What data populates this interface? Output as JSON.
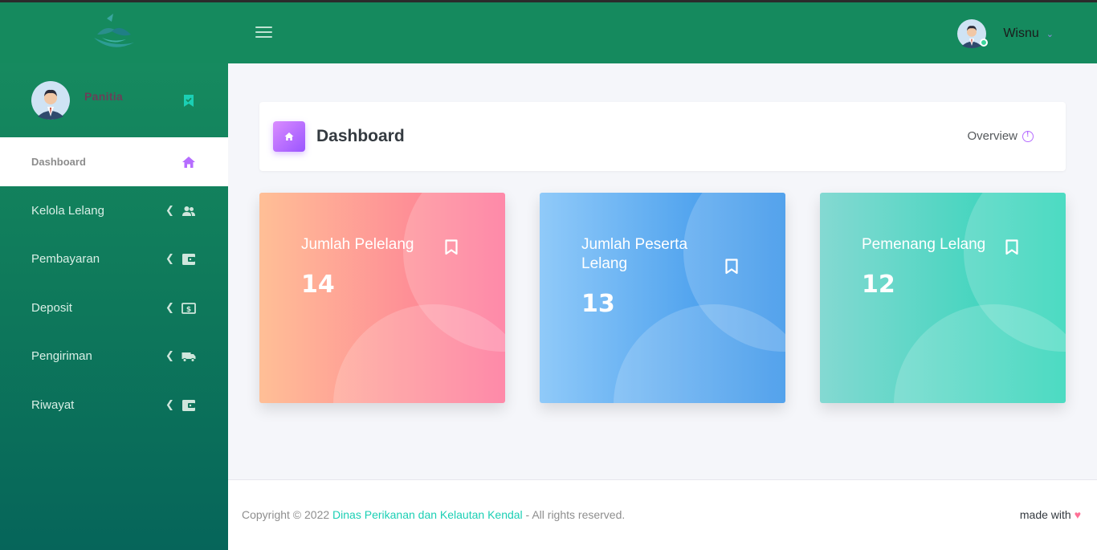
{
  "navbar": {
    "user_name": "Wisnu"
  },
  "sidebar": {
    "role": "Panitia",
    "items": [
      {
        "label": "Dashboard",
        "icon": "home-icon"
      },
      {
        "label": "Kelola Lelang",
        "icon": "users-icon"
      },
      {
        "label": "Pembayaran",
        "icon": "wallet-icon"
      },
      {
        "label": "Deposit",
        "icon": "cash-icon"
      },
      {
        "label": "Pengiriman",
        "icon": "truck-icon"
      },
      {
        "label": "Riwayat",
        "icon": "wallet-icon"
      }
    ]
  },
  "page": {
    "title": "Dashboard",
    "overview_label": "Overview"
  },
  "cards": [
    {
      "title": "Jumlah Pelelang",
      "value": "14",
      "color": "#fe7096"
    },
    {
      "title": "Jumlah Peserta Lelang",
      "value": "13",
      "color": "#2e8ee8"
    },
    {
      "title": "Pemenang Lelang",
      "value": "12",
      "color": "#25d3b5"
    }
  ],
  "footer": {
    "copyright_prefix": "Copyright © 2022 ",
    "org_link": "Dinas Perikanan dan Kelautan Kendal",
    "copyright_suffix": " - All rights reserved.",
    "made_with": "made with"
  },
  "colors": {
    "navbar": "#158a5e",
    "accent_purple": "#9a55ff",
    "link": "#1bcfb4"
  }
}
